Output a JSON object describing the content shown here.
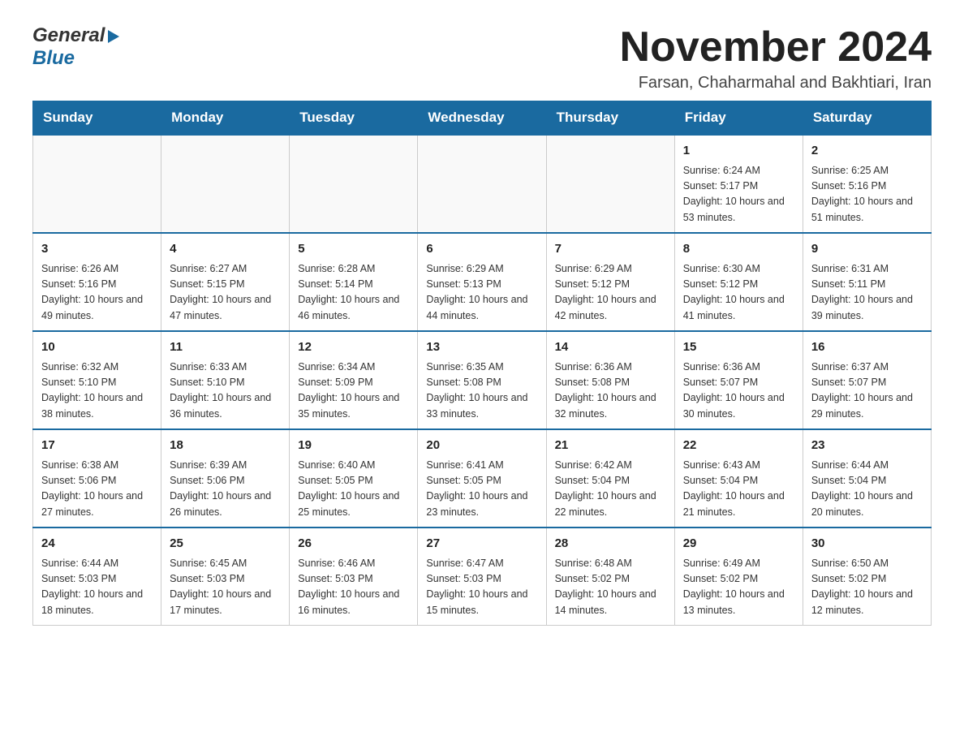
{
  "header": {
    "logo_general": "General",
    "logo_blue": "Blue",
    "month_title": "November 2024",
    "subtitle": "Farsan, Chaharmahal and Bakhtiari, Iran"
  },
  "days_of_week": [
    "Sunday",
    "Monday",
    "Tuesday",
    "Wednesday",
    "Thursday",
    "Friday",
    "Saturday"
  ],
  "weeks": [
    {
      "days": [
        {
          "number": "",
          "info": ""
        },
        {
          "number": "",
          "info": ""
        },
        {
          "number": "",
          "info": ""
        },
        {
          "number": "",
          "info": ""
        },
        {
          "number": "",
          "info": ""
        },
        {
          "number": "1",
          "info": "Sunrise: 6:24 AM\nSunset: 5:17 PM\nDaylight: 10 hours and 53 minutes."
        },
        {
          "number": "2",
          "info": "Sunrise: 6:25 AM\nSunset: 5:16 PM\nDaylight: 10 hours and 51 minutes."
        }
      ]
    },
    {
      "days": [
        {
          "number": "3",
          "info": "Sunrise: 6:26 AM\nSunset: 5:16 PM\nDaylight: 10 hours and 49 minutes."
        },
        {
          "number": "4",
          "info": "Sunrise: 6:27 AM\nSunset: 5:15 PM\nDaylight: 10 hours and 47 minutes."
        },
        {
          "number": "5",
          "info": "Sunrise: 6:28 AM\nSunset: 5:14 PM\nDaylight: 10 hours and 46 minutes."
        },
        {
          "number": "6",
          "info": "Sunrise: 6:29 AM\nSunset: 5:13 PM\nDaylight: 10 hours and 44 minutes."
        },
        {
          "number": "7",
          "info": "Sunrise: 6:29 AM\nSunset: 5:12 PM\nDaylight: 10 hours and 42 minutes."
        },
        {
          "number": "8",
          "info": "Sunrise: 6:30 AM\nSunset: 5:12 PM\nDaylight: 10 hours and 41 minutes."
        },
        {
          "number": "9",
          "info": "Sunrise: 6:31 AM\nSunset: 5:11 PM\nDaylight: 10 hours and 39 minutes."
        }
      ]
    },
    {
      "days": [
        {
          "number": "10",
          "info": "Sunrise: 6:32 AM\nSunset: 5:10 PM\nDaylight: 10 hours and 38 minutes."
        },
        {
          "number": "11",
          "info": "Sunrise: 6:33 AM\nSunset: 5:10 PM\nDaylight: 10 hours and 36 minutes."
        },
        {
          "number": "12",
          "info": "Sunrise: 6:34 AM\nSunset: 5:09 PM\nDaylight: 10 hours and 35 minutes."
        },
        {
          "number": "13",
          "info": "Sunrise: 6:35 AM\nSunset: 5:08 PM\nDaylight: 10 hours and 33 minutes."
        },
        {
          "number": "14",
          "info": "Sunrise: 6:36 AM\nSunset: 5:08 PM\nDaylight: 10 hours and 32 minutes."
        },
        {
          "number": "15",
          "info": "Sunrise: 6:36 AM\nSunset: 5:07 PM\nDaylight: 10 hours and 30 minutes."
        },
        {
          "number": "16",
          "info": "Sunrise: 6:37 AM\nSunset: 5:07 PM\nDaylight: 10 hours and 29 minutes."
        }
      ]
    },
    {
      "days": [
        {
          "number": "17",
          "info": "Sunrise: 6:38 AM\nSunset: 5:06 PM\nDaylight: 10 hours and 27 minutes."
        },
        {
          "number": "18",
          "info": "Sunrise: 6:39 AM\nSunset: 5:06 PM\nDaylight: 10 hours and 26 minutes."
        },
        {
          "number": "19",
          "info": "Sunrise: 6:40 AM\nSunset: 5:05 PM\nDaylight: 10 hours and 25 minutes."
        },
        {
          "number": "20",
          "info": "Sunrise: 6:41 AM\nSunset: 5:05 PM\nDaylight: 10 hours and 23 minutes."
        },
        {
          "number": "21",
          "info": "Sunrise: 6:42 AM\nSunset: 5:04 PM\nDaylight: 10 hours and 22 minutes."
        },
        {
          "number": "22",
          "info": "Sunrise: 6:43 AM\nSunset: 5:04 PM\nDaylight: 10 hours and 21 minutes."
        },
        {
          "number": "23",
          "info": "Sunrise: 6:44 AM\nSunset: 5:04 PM\nDaylight: 10 hours and 20 minutes."
        }
      ]
    },
    {
      "days": [
        {
          "number": "24",
          "info": "Sunrise: 6:44 AM\nSunset: 5:03 PM\nDaylight: 10 hours and 18 minutes."
        },
        {
          "number": "25",
          "info": "Sunrise: 6:45 AM\nSunset: 5:03 PM\nDaylight: 10 hours and 17 minutes."
        },
        {
          "number": "26",
          "info": "Sunrise: 6:46 AM\nSunset: 5:03 PM\nDaylight: 10 hours and 16 minutes."
        },
        {
          "number": "27",
          "info": "Sunrise: 6:47 AM\nSunset: 5:03 PM\nDaylight: 10 hours and 15 minutes."
        },
        {
          "number": "28",
          "info": "Sunrise: 6:48 AM\nSunset: 5:02 PM\nDaylight: 10 hours and 14 minutes."
        },
        {
          "number": "29",
          "info": "Sunrise: 6:49 AM\nSunset: 5:02 PM\nDaylight: 10 hours and 13 minutes."
        },
        {
          "number": "30",
          "info": "Sunrise: 6:50 AM\nSunset: 5:02 PM\nDaylight: 10 hours and 12 minutes."
        }
      ]
    }
  ]
}
